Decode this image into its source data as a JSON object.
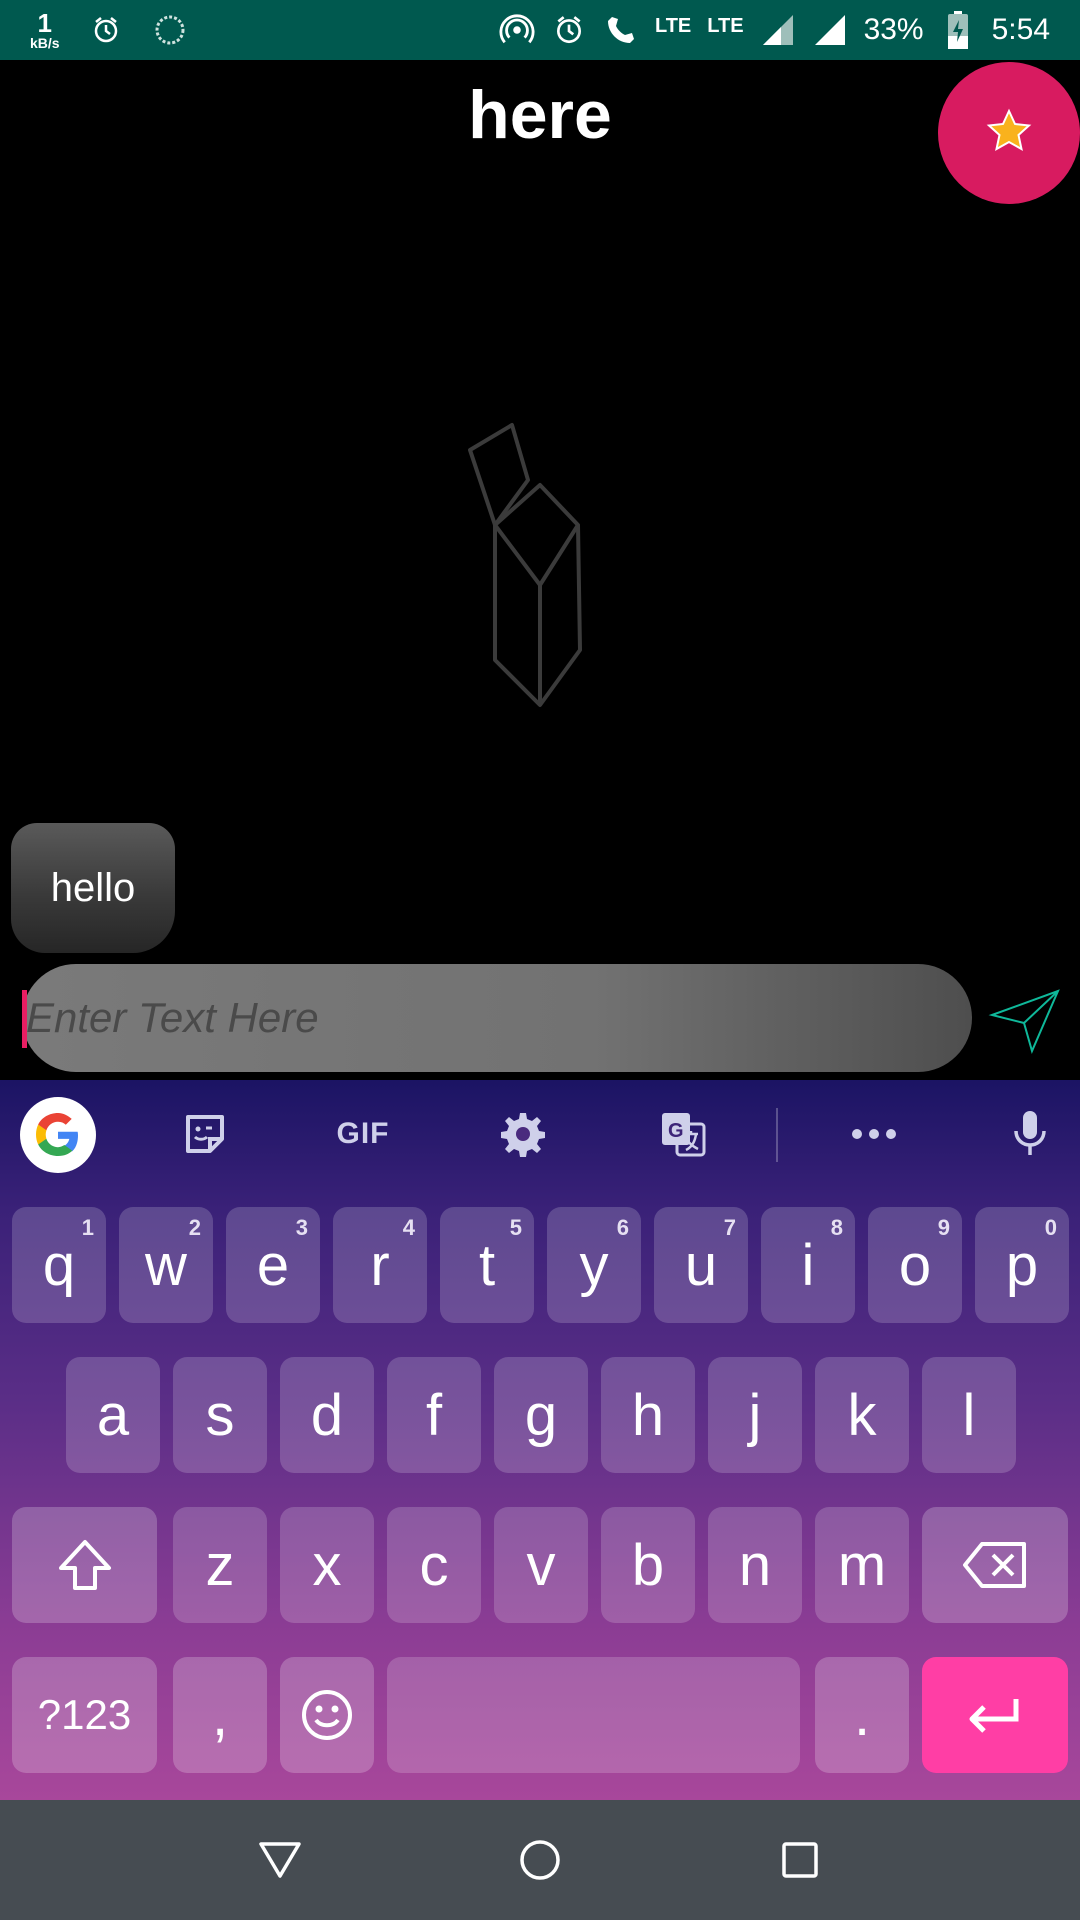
{
  "status_bar": {
    "net_speed_value": "1",
    "net_speed_unit": "kB/s",
    "lte_1": "LTE",
    "lte_2": "LTE",
    "battery": "33%",
    "time": "5:54",
    "icons": [
      "alarm-icon",
      "sync-icon",
      "hotspot-icon",
      "alarm-icon",
      "volte-call-icon",
      "signal-icon",
      "signal-icon",
      "battery-charging-icon"
    ]
  },
  "header": {
    "title": "here"
  },
  "chat": {
    "messages": [
      {
        "text": "hello"
      }
    ]
  },
  "composer": {
    "placeholder": "Enter Text Here",
    "value": ""
  },
  "keyboard": {
    "toolbar": {
      "gif_label": "GIF"
    },
    "row1": [
      {
        "label": "q",
        "hint": "1"
      },
      {
        "label": "w",
        "hint": "2"
      },
      {
        "label": "e",
        "hint": "3"
      },
      {
        "label": "r",
        "hint": "4"
      },
      {
        "label": "t",
        "hint": "5"
      },
      {
        "label": "y",
        "hint": "6"
      },
      {
        "label": "u",
        "hint": "7"
      },
      {
        "label": "i",
        "hint": "8"
      },
      {
        "label": "o",
        "hint": "9"
      },
      {
        "label": "p",
        "hint": "0"
      }
    ],
    "row2": [
      "a",
      "s",
      "d",
      "f",
      "g",
      "h",
      "j",
      "k",
      "l"
    ],
    "row3": [
      "z",
      "x",
      "c",
      "v",
      "b",
      "n",
      "m"
    ],
    "symbols_label": "?123",
    "comma_label": ",",
    "period_label": "."
  },
  "colors": {
    "status_bar": "#00594F",
    "fab": "#D81B60",
    "star": "#F9B21D",
    "enter_key": "#FF3EA5",
    "nav_bar": "#464C52"
  }
}
